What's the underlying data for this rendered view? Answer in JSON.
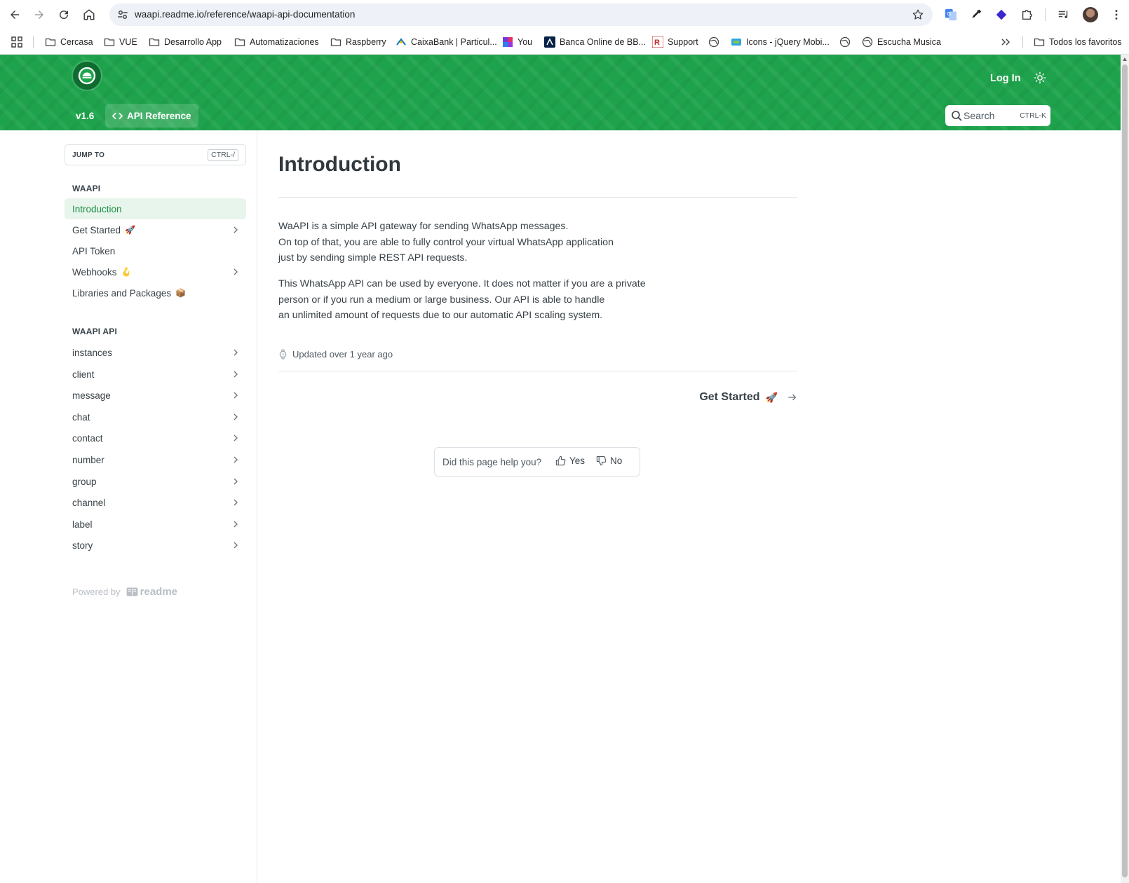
{
  "browser": {
    "url": "waapi.readme.io/reference/waapi-api-documentation",
    "bookmarks": [
      {
        "label": "Cercasa",
        "icon": "folder-icon"
      },
      {
        "label": "VUE",
        "icon": "folder-icon"
      },
      {
        "label": "Desarrollo App",
        "icon": "folder-icon"
      },
      {
        "label": "Automatizaciones",
        "icon": "folder-icon"
      },
      {
        "label": "Raspberry",
        "icon": "folder-icon"
      },
      {
        "label": "CaixaBank | Particul...",
        "icon": "caixabank-icon"
      },
      {
        "label": "You",
        "icon": "you-icon"
      },
      {
        "label": "Banca Online de BB...",
        "icon": "bbva-icon"
      },
      {
        "label": "Support",
        "icon": "support-icon"
      },
      {
        "label": "",
        "icon": "globe-icon"
      },
      {
        "label": "Icons - jQuery Mobi...",
        "icon": "jquery-icon"
      },
      {
        "label": "",
        "icon": "globe-icon"
      },
      {
        "label": "Escucha Musica",
        "icon": "globe-icon"
      }
    ],
    "all_bookmarks": "Todos los favoritos"
  },
  "header": {
    "login": "Log In",
    "version": "v1.6",
    "api_reference": "API Reference",
    "search_placeholder": "Search",
    "search_shortcut": "CTRL-K",
    "brand_color": "#1ea34c"
  },
  "sidebar": {
    "jump_to": "JUMP TO",
    "jump_shortcut": "CTRL-/",
    "sections": [
      {
        "title": "WAAPI",
        "items": [
          {
            "label": "Introduction",
            "active": true,
            "emoji": "",
            "chevron": false
          },
          {
            "label": "Get Started",
            "active": false,
            "emoji": "🚀",
            "chevron": true
          },
          {
            "label": "API Token",
            "active": false,
            "emoji": "",
            "chevron": false
          },
          {
            "label": "Webhooks",
            "active": false,
            "emoji": "🪝",
            "chevron": true
          },
          {
            "label": "Libraries and Packages",
            "active": false,
            "emoji": "📦",
            "chevron": false
          }
        ]
      },
      {
        "title": "WAAPI API",
        "items": [
          {
            "label": "instances",
            "chevron": true
          },
          {
            "label": "client",
            "chevron": true
          },
          {
            "label": "message",
            "chevron": true
          },
          {
            "label": "chat",
            "chevron": true
          },
          {
            "label": "contact",
            "chevron": true
          },
          {
            "label": "number",
            "chevron": true
          },
          {
            "label": "group",
            "chevron": true
          },
          {
            "label": "channel",
            "chevron": true
          },
          {
            "label": "label",
            "chevron": true
          },
          {
            "label": "story",
            "chevron": true
          }
        ]
      }
    ],
    "powered_by": "Powered by",
    "powered_brand": "readme"
  },
  "main": {
    "title": "Introduction",
    "paragraph1": [
      "WaAPI is a simple API gateway for sending WhatsApp messages.",
      "On top of that, you are able to fully control your virtual WhatsApp application",
      "just by sending simple REST API requests."
    ],
    "paragraph2": [
      "This WhatsApp API can be used by everyone. It does not matter if you are a private",
      "person or if you run a medium or large business. Our API is able to handle",
      "an unlimited amount of requests due to our automatic API scaling system."
    ],
    "updated": "Updated over 1 year ago",
    "next_label": "Get Started",
    "next_emoji": "🚀",
    "feedback_question": "Did this page help you?",
    "feedback_yes": "Yes",
    "feedback_no": "No"
  }
}
